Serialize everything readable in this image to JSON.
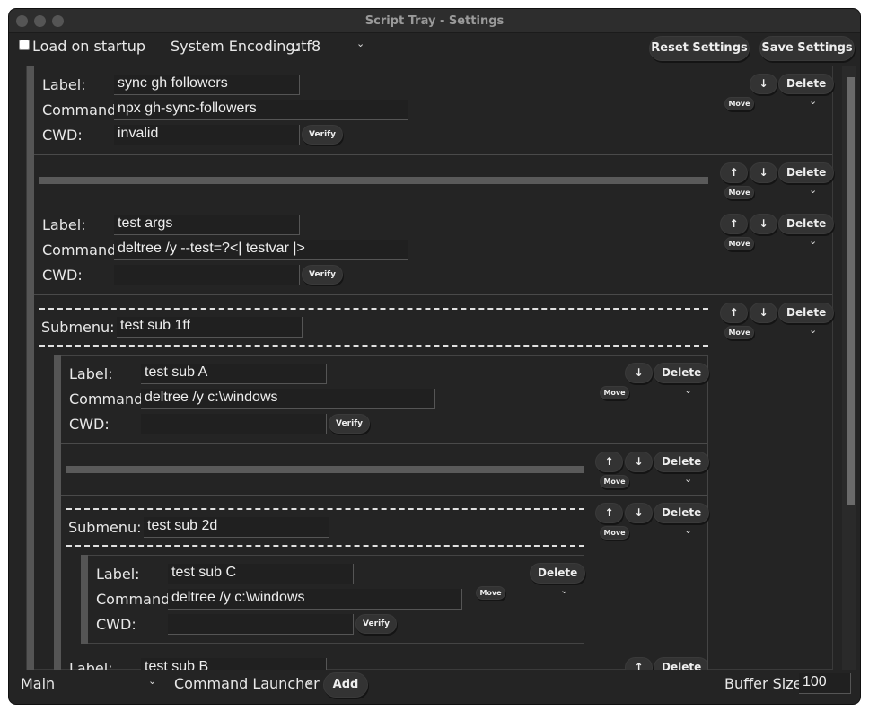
{
  "window": {
    "title": "Script Tray - Settings"
  },
  "topbar": {
    "load_on_startup": "Load on startup",
    "encoding_label": "System Encoding:",
    "encoding_value": "utf8",
    "reset": "Reset Settings",
    "save": "Save Settings"
  },
  "common": {
    "label": "Label:",
    "command": "Command:",
    "cwd": "CWD:",
    "submenu": "Submenu:",
    "verify": "Verify",
    "delete": "Delete",
    "move": "Move",
    "up": "↑",
    "down": "↓",
    "chevron": "⌄"
  },
  "items": {
    "item1": {
      "label": "sync gh followers",
      "command": "npx gh-sync-followers",
      "cwd": "invalid"
    },
    "item2": {
      "label": "test args",
      "command": "deltree /y --test=?<| testvar |>",
      "cwd": ""
    },
    "submenu1": {
      "name": "test sub 1ff"
    },
    "subA": {
      "label": "test sub A",
      "command": "deltree /y c:\\windows",
      "cwd": ""
    },
    "submenu2": {
      "name": "test sub 2d"
    },
    "subC": {
      "label": "test sub C",
      "command": "deltree /y c:\\windows",
      "cwd": ""
    },
    "subB": {
      "label": "test sub B"
    }
  },
  "bottombar": {
    "menu_value": "Main",
    "mode_value": "Command Launcher",
    "add": "Add",
    "buffer_label": "Buffer Size:",
    "buffer_value": "100"
  }
}
